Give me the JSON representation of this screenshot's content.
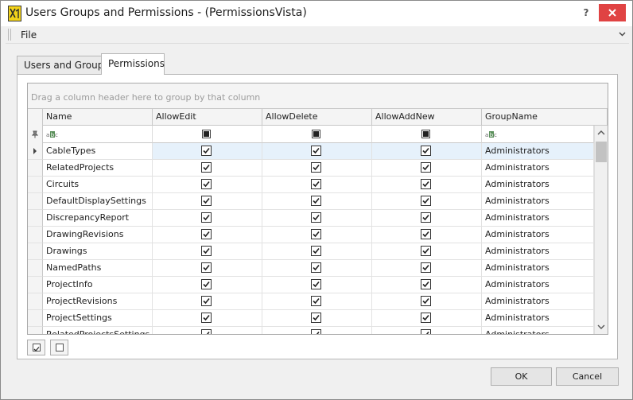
{
  "window": {
    "title": "Users Groups and Permissions - (PermissionsVista)",
    "help_label": "?",
    "accent": "#e04343"
  },
  "menu": {
    "file_label": "File"
  },
  "tabs": [
    {
      "label": "Users and Groups",
      "selected": false
    },
    {
      "label": "Permissions",
      "selected": true
    }
  ],
  "grid": {
    "group_hint": "Drag a column header here to group by that column",
    "columns": [
      "Name",
      "AllowEdit",
      "AllowDelete",
      "AllowAddNew",
      "GroupName"
    ],
    "filter_text_icon": "abc-filter-icon",
    "rows": [
      {
        "name": "CableTypes",
        "edit": true,
        "delete": true,
        "add": true,
        "group": "Administrators",
        "focused": true
      },
      {
        "name": "RelatedProjects",
        "edit": true,
        "delete": true,
        "add": true,
        "group": "Administrators"
      },
      {
        "name": "Circuits",
        "edit": true,
        "delete": true,
        "add": true,
        "group": "Administrators"
      },
      {
        "name": "DefaultDisplaySettings",
        "edit": true,
        "delete": true,
        "add": true,
        "group": "Administrators"
      },
      {
        "name": "DiscrepancyReport",
        "edit": true,
        "delete": true,
        "add": true,
        "group": "Administrators"
      },
      {
        "name": "DrawingRevisions",
        "edit": true,
        "delete": true,
        "add": true,
        "group": "Administrators"
      },
      {
        "name": "Drawings",
        "edit": true,
        "delete": true,
        "add": true,
        "group": "Administrators"
      },
      {
        "name": "NamedPaths",
        "edit": true,
        "delete": true,
        "add": true,
        "group": "Administrators"
      },
      {
        "name": "ProjectInfo",
        "edit": true,
        "delete": true,
        "add": true,
        "group": "Administrators"
      },
      {
        "name": "ProjectRevisions",
        "edit": true,
        "delete": true,
        "add": true,
        "group": "Administrators"
      },
      {
        "name": "ProjectSettings",
        "edit": true,
        "delete": true,
        "add": true,
        "group": "Administrators"
      },
      {
        "name": "RelatedProjectsSettings",
        "edit": true,
        "delete": true,
        "add": true,
        "group": "Administrators"
      }
    ]
  },
  "buttons": {
    "ok": "OK",
    "cancel": "Cancel"
  }
}
